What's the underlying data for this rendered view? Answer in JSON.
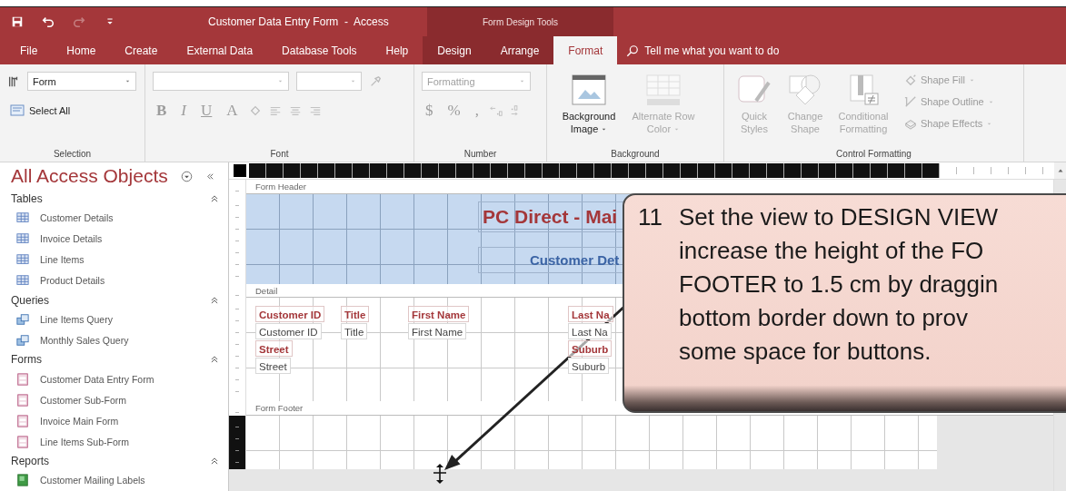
{
  "window": {
    "title": "Customer Data Entry Form  -  Access",
    "context_title": "Form Design Tools"
  },
  "quick_access": [
    {
      "kind": "save",
      "disabled": false
    },
    {
      "kind": "undo",
      "disabled": false
    },
    {
      "kind": "redo",
      "disabled": true
    },
    {
      "kind": "customize",
      "disabled": false
    }
  ],
  "tabs": [
    {
      "label": "File",
      "selected": false,
      "contextual": false
    },
    {
      "label": "Home",
      "selected": false,
      "contextual": false
    },
    {
      "label": "Create",
      "selected": false,
      "contextual": false
    },
    {
      "label": "External Data",
      "selected": false,
      "contextual": false
    },
    {
      "label": "Database Tools",
      "selected": false,
      "contextual": false
    },
    {
      "label": "Help",
      "selected": false,
      "contextual": false
    },
    {
      "label": "Design",
      "selected": false,
      "contextual": true
    },
    {
      "label": "Arrange",
      "selected": false,
      "contextual": true
    },
    {
      "label": "Format",
      "selected": true,
      "contextual": true
    }
  ],
  "tell_me": {
    "placeholder": "Tell me what you want to do"
  },
  "ribbon": {
    "selection": {
      "label": "Selection",
      "object_combo": "Form",
      "select_all": "Select All"
    },
    "font": {
      "label": "Font",
      "disabled": true,
      "buttons": [
        {
          "kind": "bold",
          "glyph": "B"
        },
        {
          "kind": "italic",
          "glyph": "I"
        },
        {
          "kind": "underline",
          "glyph": "U"
        },
        {
          "kind": "font-color",
          "glyph": "A"
        }
      ]
    },
    "number": {
      "label": "Number",
      "disabled": true,
      "format_combo": {
        "placeholder": "Formatting"
      },
      "buttons": [
        "$",
        "%",
        ","
      ]
    },
    "background": {
      "label": "Background",
      "buttons": [
        {
          "kind": "image",
          "label": "Background Image",
          "disabled": false
        },
        {
          "kind": "rows",
          "label": "Alternate Row Color",
          "disabled": true
        }
      ]
    },
    "control_formatting": {
      "label": "Control Formatting",
      "disabled": true,
      "large": [
        {
          "kind": "styles",
          "label": "Quick Styles"
        },
        {
          "kind": "shape",
          "label": "Change Shape"
        },
        {
          "kind": "conditional",
          "label": "Conditional Formatting"
        }
      ],
      "small": [
        {
          "kind": "fill",
          "label": "Shape Fill"
        },
        {
          "kind": "outline",
          "label": "Shape Outline"
        },
        {
          "kind": "effects",
          "label": "Shape Effects"
        }
      ]
    }
  },
  "navigation": {
    "title": "All Access Objects",
    "groups": [
      {
        "label": "Tables",
        "expanded": true,
        "items": [
          {
            "label": "Customer Details",
            "kind": "table"
          },
          {
            "label": "Invoice Details",
            "kind": "table"
          },
          {
            "label": "Line Items",
            "kind": "table"
          },
          {
            "label": "Product Details",
            "kind": "table"
          }
        ]
      },
      {
        "label": "Queries",
        "expanded": true,
        "items": [
          {
            "label": "Line Items Query",
            "kind": "query"
          },
          {
            "label": "Monthly Sales Query",
            "kind": "query"
          }
        ]
      },
      {
        "label": "Forms",
        "expanded": true,
        "items": [
          {
            "label": "Customer Data Entry Form",
            "kind": "form"
          },
          {
            "label": "Customer Sub-Form",
            "kind": "form"
          },
          {
            "label": "Invoice Main Form",
            "kind": "form"
          },
          {
            "label": "Line Items Sub-Form",
            "kind": "form"
          }
        ]
      },
      {
        "label": "Reports",
        "expanded": true,
        "items": [
          {
            "label": "Customer Mailing Labels",
            "kind": "report"
          }
        ]
      }
    ]
  },
  "form_design": {
    "sections": [
      {
        "kind": "header",
        "label": "Form Header",
        "selected": false
      },
      {
        "kind": "detail",
        "label": "Detail",
        "selected": false
      },
      {
        "kind": "footer",
        "label": "Form Footer",
        "selected": true
      }
    ],
    "header_controls": [
      {
        "kind": "title",
        "text": "PC Direct - Mai"
      },
      {
        "kind": "subtitle",
        "text": "Customer Det"
      }
    ],
    "detail_rows": [
      [
        {
          "kind": "label",
          "text": "Customer ID"
        },
        {
          "kind": "label",
          "text": "Title"
        },
        {
          "kind": "label",
          "text": "First Name"
        },
        {
          "kind": "label",
          "text": "Last Na"
        }
      ],
      [
        {
          "kind": "field",
          "text": "Customer ID"
        },
        {
          "kind": "field",
          "text": "Title"
        },
        {
          "kind": "field",
          "text": "First Name"
        },
        {
          "kind": "field",
          "text": "Last Na"
        }
      ],
      [
        {
          "kind": "label",
          "text": "Street"
        },
        {
          "kind": "label",
          "text": "Suburb"
        }
      ],
      [
        {
          "kind": "field",
          "text": "Street"
        },
        {
          "kind": "field",
          "text": "Suburb"
        }
      ]
    ]
  },
  "callout": {
    "number": "11",
    "lines": [
      "Set the view to DESIGN VIEW",
      "increase the height of the FO",
      "FOOTER to 1.5 cm by draggin",
      "bottom border down to prov",
      "some space for buttons."
    ]
  }
}
